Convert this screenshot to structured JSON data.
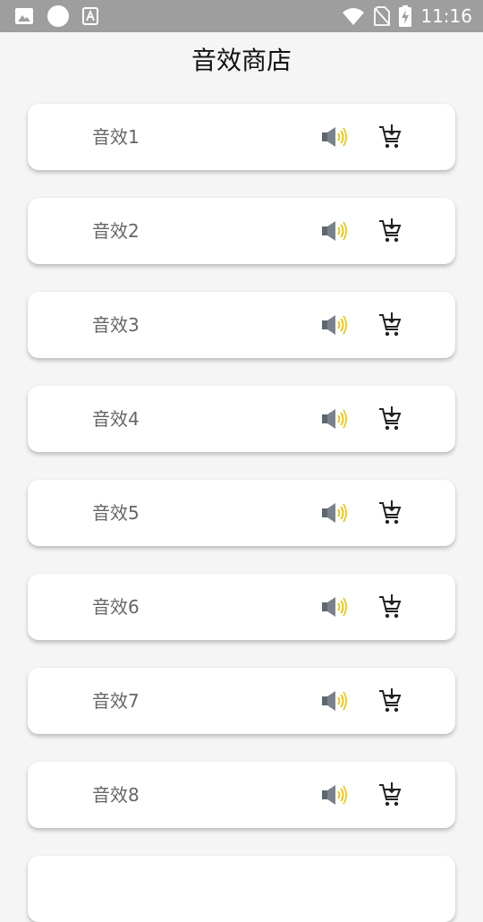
{
  "status_bar": {
    "time": "11:16",
    "left_icons": [
      "image-icon",
      "circle-icon",
      "font-icon"
    ],
    "right_icons": [
      "wifi-icon",
      "no-sim-icon",
      "battery-charging-icon"
    ]
  },
  "page": {
    "title": "音效商店"
  },
  "items": [
    {
      "label": "音效1"
    },
    {
      "label": "音效2"
    },
    {
      "label": "音效3"
    },
    {
      "label": "音效4"
    },
    {
      "label": "音效5"
    },
    {
      "label": "音效6"
    },
    {
      "label": "音效7"
    },
    {
      "label": "音效8"
    }
  ],
  "colors": {
    "status_bar": "#9e9e9e",
    "background": "#f5f5f5",
    "card": "#ffffff",
    "label_text": "#666666",
    "speaker_body": "#5f6670",
    "speaker_waves": "#f2c200",
    "cart": "#222222"
  }
}
